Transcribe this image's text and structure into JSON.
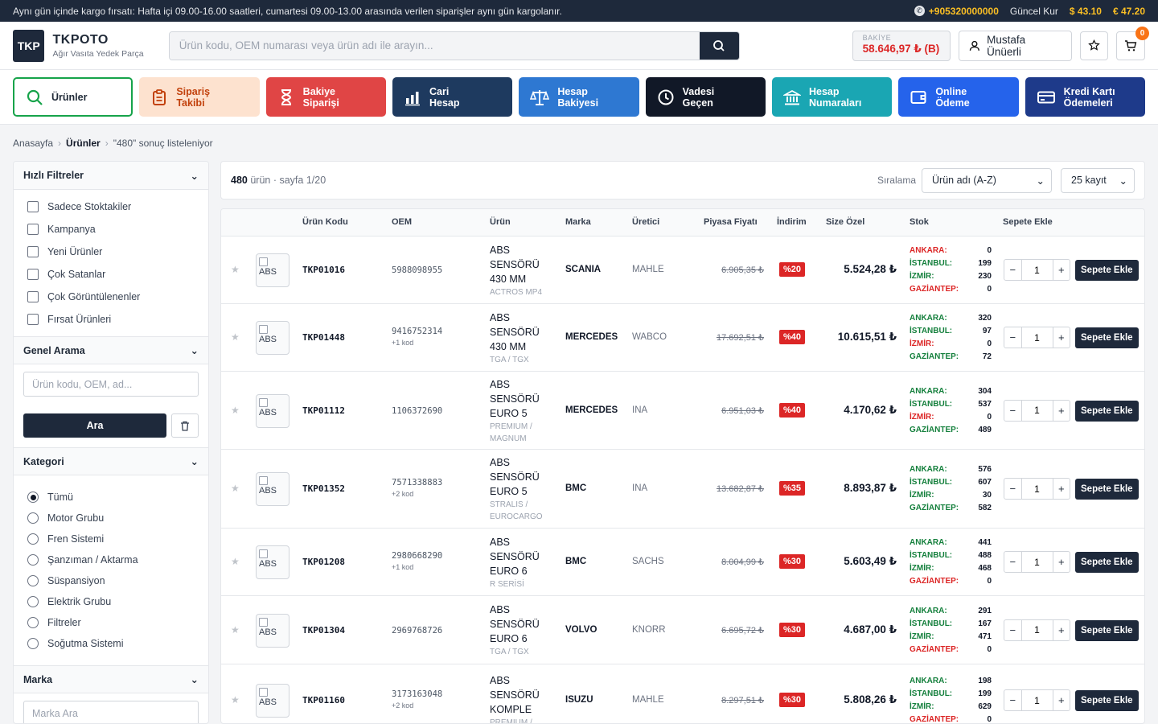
{
  "topbar": {
    "notice": "Aynı gün içinde kargo fırsatı: Hafta içi 09.00-16.00 saatleri, cumartesi 09.00-13.00 arasında verilen siparişler aynı gün kargolanır.",
    "phone": "+905320000000",
    "rate_label": "Güncel Kur",
    "usd": "$ 43.10",
    "eur": "€ 47.20"
  },
  "header": {
    "logo": "TKP",
    "brand": "TKPOTO",
    "tagline": "Ağır Vasıta Yedek Parça",
    "search_placeholder": "Ürün kodu, OEM numarası veya ürün adı ile arayın...",
    "balance_label": "BAKİYE",
    "balance_value": "58.646,97 ₺ (B)",
    "user": "Mustafa Ünüerli",
    "cart_count": "0"
  },
  "nav": [
    {
      "l1": "Ürünler",
      "l2": "",
      "icon": "search-icon"
    },
    {
      "l1": "Sipariş",
      "l2": "Takibi",
      "icon": "clipboard-icon"
    },
    {
      "l1": "Bakiye",
      "l2": "Siparişi",
      "icon": "hourglass-icon"
    },
    {
      "l1": "Cari",
      "l2": "Hesap",
      "icon": "bar-chart-icon"
    },
    {
      "l1": "Hesap",
      "l2": "Bakiyesi",
      "icon": "scale-icon"
    },
    {
      "l1": "Vadesi",
      "l2": "Geçen",
      "icon": "clock-icon"
    },
    {
      "l1": "Hesap",
      "l2": "Numaraları",
      "icon": "bank-icon"
    },
    {
      "l1": "Online",
      "l2": "Ödeme",
      "icon": "wallet-icon"
    },
    {
      "l1": "Kredi Kartı",
      "l2": "Ödemeleri",
      "icon": "credit-card-icon"
    }
  ],
  "breadcrumb": {
    "home": "Anasayfa",
    "current": "Ürünler",
    "result": "\"480\" sonuç listeleniyor"
  },
  "sidebar": {
    "quick_title": "Hızlı Filtreler",
    "quick": [
      "Sadece Stoktakiler",
      "Kampanya",
      "Yeni Ürünler",
      "Çok Satanlar",
      "Çok Görüntülenenler",
      "Fırsat Ürünleri"
    ],
    "general_title": "Genel Arama",
    "general_placeholder": "Ürün kodu, OEM, ad...",
    "search_button": "Ara",
    "category_title": "Kategori",
    "categories": [
      "Tümü",
      "Motor Grubu",
      "Fren Sistemi",
      "Şanzıman / Aktarma",
      "Süspansiyon",
      "Elektrik Grubu",
      "Filtreler",
      "Soğutma Sistemi"
    ],
    "brand_title": "Marka",
    "brand_placeholder": "Marka Ara"
  },
  "list": {
    "count": "480",
    "count_suffix": "ürün · sayfa 1/20",
    "sort_label": "Sıralama",
    "sort_value": "Ürün adı (A-Z)",
    "per_page": "25 kayıt"
  },
  "columns": [
    "Ürün Kodu",
    "OEM",
    "Ürün",
    "Marka",
    "Üretici",
    "Piyasa Fiyatı",
    "İndirim",
    "Size Özel",
    "Stok",
    "Sepete Ekle"
  ],
  "img_alt": "ABS",
  "stock_labels": [
    "ANKARA:",
    "İSTANBUL:",
    "İZMİR:",
    "GAZİANTEP:"
  ],
  "add_label": "Sepete Ekle",
  "qty_default": "1",
  "rows": [
    {
      "code": "TKP01016",
      "oem": "5988098955",
      "oem_more": "",
      "name": [
        "ABS",
        "SENSÖRÜ",
        "430 MM"
      ],
      "model": [
        "ACTROS MP4"
      ],
      "brand": "SCANIA",
      "maker": "MAHLE",
      "market": "6.905,35 ₺",
      "disc": "%20",
      "price": "5.524,28 ₺",
      "stock": [
        "0",
        "199",
        "230",
        "0"
      ]
    },
    {
      "code": "TKP01448",
      "oem": "9416752314",
      "oem_more": "+1  kod",
      "name": [
        "ABS",
        "SENSÖRÜ",
        "430 MM"
      ],
      "model": [
        "TGA / TGX"
      ],
      "brand": "MERCEDES",
      "maker": "WABCO",
      "market": "17.692,51 ₺",
      "disc": "%40",
      "price": "10.615,51 ₺",
      "stock": [
        "320",
        "97",
        "0",
        "72"
      ]
    },
    {
      "code": "TKP01112",
      "oem": "1106372690",
      "oem_more": "",
      "name": [
        "ABS",
        "SENSÖRÜ",
        "EURO 5"
      ],
      "model": [
        "PREMIUM /",
        "MAGNUM"
      ],
      "brand": "MERCEDES",
      "maker": "INA",
      "market": "6.951,03 ₺",
      "disc": "%40",
      "price": "4.170,62 ₺",
      "stock": [
        "304",
        "537",
        "0",
        "489"
      ]
    },
    {
      "code": "TKP01352",
      "oem": "7571338883",
      "oem_more": "+2  kod",
      "name": [
        "ABS",
        "SENSÖRÜ",
        "EURO 5"
      ],
      "model": [
        "STRALIS /",
        "EUROCARGO"
      ],
      "brand": "BMC",
      "maker": "INA",
      "market": "13.682,87 ₺",
      "disc": "%35",
      "price": "8.893,87 ₺",
      "stock": [
        "576",
        "607",
        "30",
        "582"
      ]
    },
    {
      "code": "TKP01208",
      "oem": "2980668290",
      "oem_more": "+1  kod",
      "name": [
        "ABS",
        "SENSÖRÜ",
        "EURO 6"
      ],
      "model": [
        "R SERİSİ"
      ],
      "brand": "BMC",
      "maker": "SACHS",
      "market": "8.004,99 ₺",
      "disc": "%30",
      "price": "5.603,49 ₺",
      "stock": [
        "441",
        "488",
        "468",
        "0"
      ]
    },
    {
      "code": "TKP01304",
      "oem": "2969768726",
      "oem_more": "",
      "name": [
        "ABS",
        "SENSÖRÜ",
        "EURO 6"
      ],
      "model": [
        "TGA / TGX"
      ],
      "brand": "VOLVO",
      "maker": "KNORR",
      "market": "6.695,72 ₺",
      "disc": "%30",
      "price": "4.687,00 ₺",
      "stock": [
        "291",
        "167",
        "471",
        "0"
      ]
    },
    {
      "code": "TKP01160",
      "oem": "3173163048",
      "oem_more": "+2  kod",
      "name": [
        "ABS",
        "SENSÖRÜ",
        "KOMPLE"
      ],
      "model": [
        "PREMIUM /"
      ],
      "brand": "ISUZU",
      "maker": "MAHLE",
      "market": "8.297,51 ₺",
      "disc": "%30",
      "price": "5.808,26 ₺",
      "stock": [
        "198",
        "199",
        "629",
        "0"
      ]
    }
  ],
  "colors": {
    "accent": "#1e293b",
    "discount": "#dc2626",
    "stock_ok": "#15803d",
    "stock_zero": "#dc2626"
  }
}
